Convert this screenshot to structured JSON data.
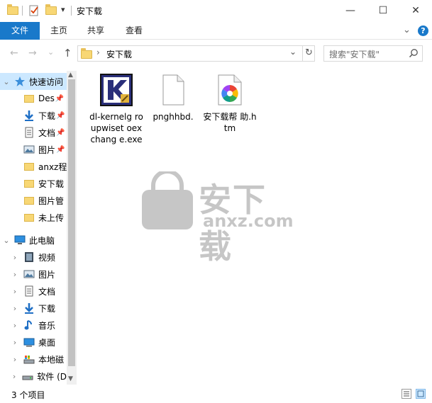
{
  "window": {
    "title": "安下载",
    "controls": {
      "minimize": "—",
      "maximize": "☐",
      "close": "✕"
    }
  },
  "ribbon": {
    "tabs": [
      "文件",
      "主页",
      "共享",
      "查看"
    ],
    "help": "?",
    "expand": "⌄"
  },
  "nav": {
    "back": "←",
    "forward": "→",
    "recent": "⌄",
    "up": "↑"
  },
  "address": {
    "separator": "›",
    "path": "安下载",
    "dropdown": "⌄",
    "refresh": "↻"
  },
  "search": {
    "placeholder": "搜索\"安下载\"",
    "icon": "search-icon"
  },
  "sidebar": {
    "quick_access": {
      "label": "快速访问",
      "items": [
        {
          "label": "Des",
          "pinned": true,
          "icon": "folder-icon"
        },
        {
          "label": "下载",
          "pinned": true,
          "icon": "download-icon"
        },
        {
          "label": "文档",
          "pinned": true,
          "icon": "document-icon"
        },
        {
          "label": "图片",
          "pinned": true,
          "icon": "picture-icon"
        },
        {
          "label": "anxz程",
          "pinned": false,
          "icon": "folder-icon"
        },
        {
          "label": "安下载",
          "pinned": false,
          "icon": "folder-icon"
        },
        {
          "label": "图片管",
          "pinned": false,
          "icon": "folder-icon"
        },
        {
          "label": "未上传",
          "pinned": false,
          "icon": "folder-icon"
        }
      ]
    },
    "this_pc": {
      "label": "此电脑",
      "items": [
        {
          "label": "视频",
          "icon": "video-icon"
        },
        {
          "label": "图片",
          "icon": "picture-icon"
        },
        {
          "label": "文档",
          "icon": "document-icon"
        },
        {
          "label": "下载",
          "icon": "download-icon"
        },
        {
          "label": "音乐",
          "icon": "music-icon"
        },
        {
          "label": "桌面",
          "icon": "desktop-icon"
        },
        {
          "label": "本地磁",
          "icon": "local-disk-icon"
        },
        {
          "label": "软件 (D",
          "icon": "drive-icon"
        }
      ]
    }
  },
  "files": [
    {
      "name": "dl-kernelg roupwiset oexchang e.exe",
      "icon": "kernel-app-icon"
    },
    {
      "name": "pnghhbd.",
      "icon": "blank-file-icon"
    },
    {
      "name": "安下载帮 助.htm",
      "icon": "htm-file-icon"
    }
  ],
  "watermark": {
    "text": "安下载",
    "sub": "anxz.com"
  },
  "status": {
    "count": "3 个项目"
  },
  "colors": {
    "accent": "#1979ca",
    "folder": "#f8d775"
  }
}
